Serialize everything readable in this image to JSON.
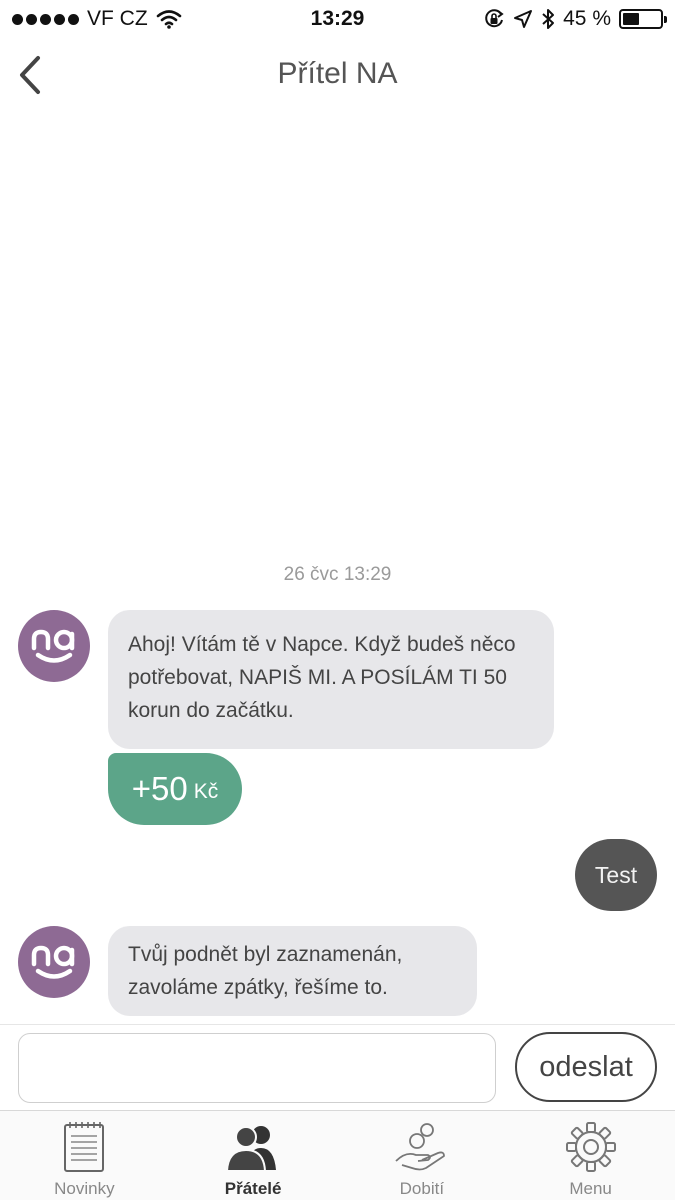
{
  "status_bar": {
    "carrier": "VF CZ",
    "time": "13:29",
    "battery_text": "45 %",
    "battery_level": 0.45
  },
  "header": {
    "title": "Přítel NA",
    "back_icon": "chevron-left-icon"
  },
  "chat": {
    "date": "26 čvc 13:29",
    "messages": [
      {
        "sender": "NA",
        "text": "Ahoj! Vítám tě v Napce. Když budeš něco potřebovat, NAPIŠ MI. A POSÍLÁM TI 50 korun do začátku."
      },
      {
        "sender": "me",
        "text": "Test"
      },
      {
        "sender": "NA",
        "text": "Tvůj podnět byl zaznamenán, zavoláme zpátky, řešíme to."
      }
    ],
    "credit": {
      "amount": "+50",
      "unit": "Kč"
    },
    "avatar_text": "na",
    "colors": {
      "avatar": "#8e6a94",
      "credit": "#5ca589",
      "outgoing": "#555555",
      "incoming": "#e7e7ea"
    }
  },
  "input": {
    "value": "",
    "placeholder": "",
    "send_label": "odeslat"
  },
  "tabs": [
    {
      "label": "Novinky",
      "icon": "notepad-icon",
      "active": false
    },
    {
      "label": "Přátelé",
      "icon": "people-icon",
      "active": true
    },
    {
      "label": "Dobití",
      "icon": "hand-coins-icon",
      "active": false
    },
    {
      "label": "Menu",
      "icon": "gear-icon",
      "active": false
    }
  ]
}
